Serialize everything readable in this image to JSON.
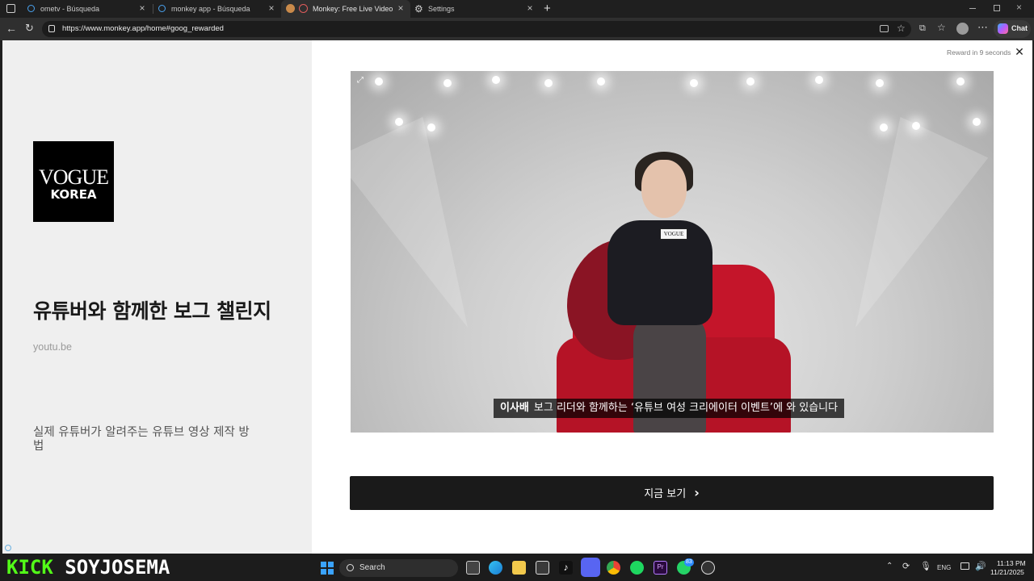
{
  "browser": {
    "tabs": [
      {
        "label": "ometv - Búsqueda",
        "icon": "search-icon"
      },
      {
        "label": "monkey app - Búsqueda",
        "icon": "search-icon"
      },
      {
        "label": "Monkey: Free Live Video Ch",
        "icon": "monkey-icon",
        "active": true
      },
      {
        "label": "Settings",
        "icon": "gear-icon"
      }
    ],
    "new_tab": "+",
    "url": "https://www.monkey.app/home#goog_rewarded",
    "chat_label": "Chat"
  },
  "ad": {
    "logo_line1": "VOGUE",
    "logo_line2": "KOREA",
    "title": "유튜버와 함께한 보그 챌린지",
    "domain": "youtu.be",
    "description": "실제 유튜버가 알려주는 유튜브 영상 제작 방법",
    "reward_text": "Reward in 9 seconds",
    "close_glyph": "✕",
    "video": {
      "mic_label": "VOGUE",
      "subtitle_name": "이사배",
      "subtitle_text": "보그 리더와 함께하는 ‘유튜브 여성 크리에이터 이벤트’에 와 있습니다"
    },
    "cta_label": "지금 보기",
    "cta_chevron": "›"
  },
  "taskbar": {
    "overlay_kick": "KICK",
    "overlay_name": "SOYJOSEMA",
    "search_placeholder": "Search",
    "lang": "ENG",
    "time": "11:13 PM",
    "date": "11/21/2025",
    "badge_count": "83"
  },
  "colors": {
    "kick_green": "#53fc18",
    "cta_bg": "#1a1a1a",
    "chair_red": "#c4152a"
  }
}
